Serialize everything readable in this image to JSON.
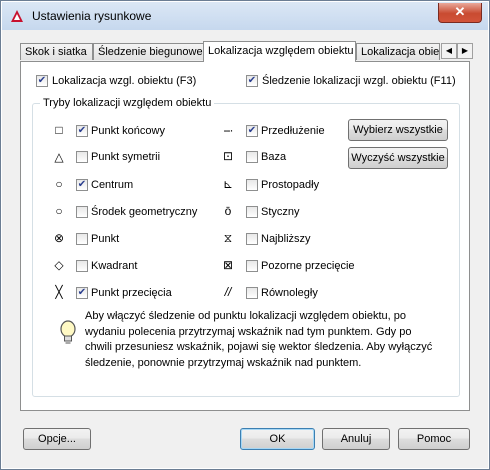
{
  "window": {
    "title": "Ustawienia rysunkowe",
    "close": "✕"
  },
  "tabs": [
    "Skok i siatka",
    "Śledzenie biegunowe",
    "Lokalizacja względem obiektu",
    "Lokalizacja obiek"
  ],
  "top_options": {
    "snap_on": {
      "label": "Lokalizacja wzgl. obiektu (F3)",
      "checked": true
    },
    "tracking_on": {
      "label": "Śledzenie lokalizacji wzgl. obiektu (F11)",
      "checked": true
    }
  },
  "group_title": "Tryby lokalizacji względem obiektu",
  "modes_left": [
    {
      "symbol": "□",
      "label": "Punkt końcowy",
      "checked": true
    },
    {
      "symbol": "△",
      "label": "Punkt symetrii",
      "checked": false
    },
    {
      "symbol": "○",
      "label": "Centrum",
      "checked": true
    },
    {
      "symbol": "○",
      "label": "Środek geometryczny",
      "checked": false
    },
    {
      "symbol": "⊗",
      "label": "Punkt",
      "checked": false
    },
    {
      "symbol": "◇",
      "label": "Kwadrant",
      "checked": false
    },
    {
      "symbol": "╳",
      "label": "Punkt przecięcia",
      "checked": true
    }
  ],
  "modes_right": [
    {
      "symbol": "--·",
      "label": "Przedłużenie",
      "checked": true
    },
    {
      "symbol": "⊡",
      "label": "Baza",
      "checked": false
    },
    {
      "symbol": "⊾",
      "label": "Prostopadły",
      "checked": false
    },
    {
      "symbol": "ō",
      "label": "Styczny",
      "checked": false
    },
    {
      "symbol": "⧖",
      "label": "Najbliższy",
      "checked": false
    },
    {
      "symbol": "⊠",
      "label": "Pozorne przecięcie",
      "checked": false
    },
    {
      "symbol": "//",
      "label": "Równoległy",
      "checked": false
    }
  ],
  "buttons": {
    "select_all": "Wybierz wszystkie",
    "clear_all": "Wyczyść wszystkie",
    "options": "Opcje...",
    "ok": "OK",
    "cancel": "Anuluj",
    "help": "Pomoc"
  },
  "hint_text": "Aby włączyć śledzenie od punktu lokalizacji względem obiektu, po wydaniu polecenia przytrzymaj wskaźnik nad tym punktem. Gdy po chwili przesuniesz wskaźnik, pojawi się wektor śledzenia. Aby wyłączyć śledzenie, ponownie przytrzymaj wskaźnik nad punktem."
}
